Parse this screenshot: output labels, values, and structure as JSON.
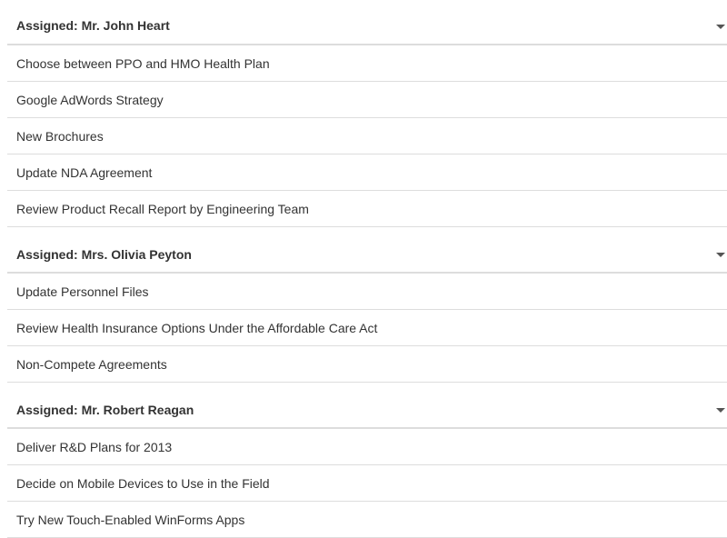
{
  "groups": [
    {
      "title": "Assigned: Mr. John Heart",
      "items": [
        "Choose between PPO and HMO Health Plan",
        "Google AdWords Strategy",
        "New Brochures",
        "Update NDA Agreement",
        "Review Product Recall Report by Engineering Team"
      ]
    },
    {
      "title": "Assigned: Mrs. Olivia Peyton",
      "items": [
        "Update Personnel Files",
        "Review Health Insurance Options Under the Affordable Care Act",
        "Non-Compete Agreements"
      ]
    },
    {
      "title": "Assigned: Mr. Robert Reagan",
      "items": [
        "Deliver R&D Plans for 2013",
        "Decide on Mobile Devices to Use in the Field",
        "Try New Touch-Enabled WinForms Apps"
      ]
    }
  ],
  "icons": {
    "group_toggle": "caret-down-icon"
  },
  "colors": {
    "text": "#333333",
    "separator": "#dddddd",
    "caret": "#555555"
  }
}
